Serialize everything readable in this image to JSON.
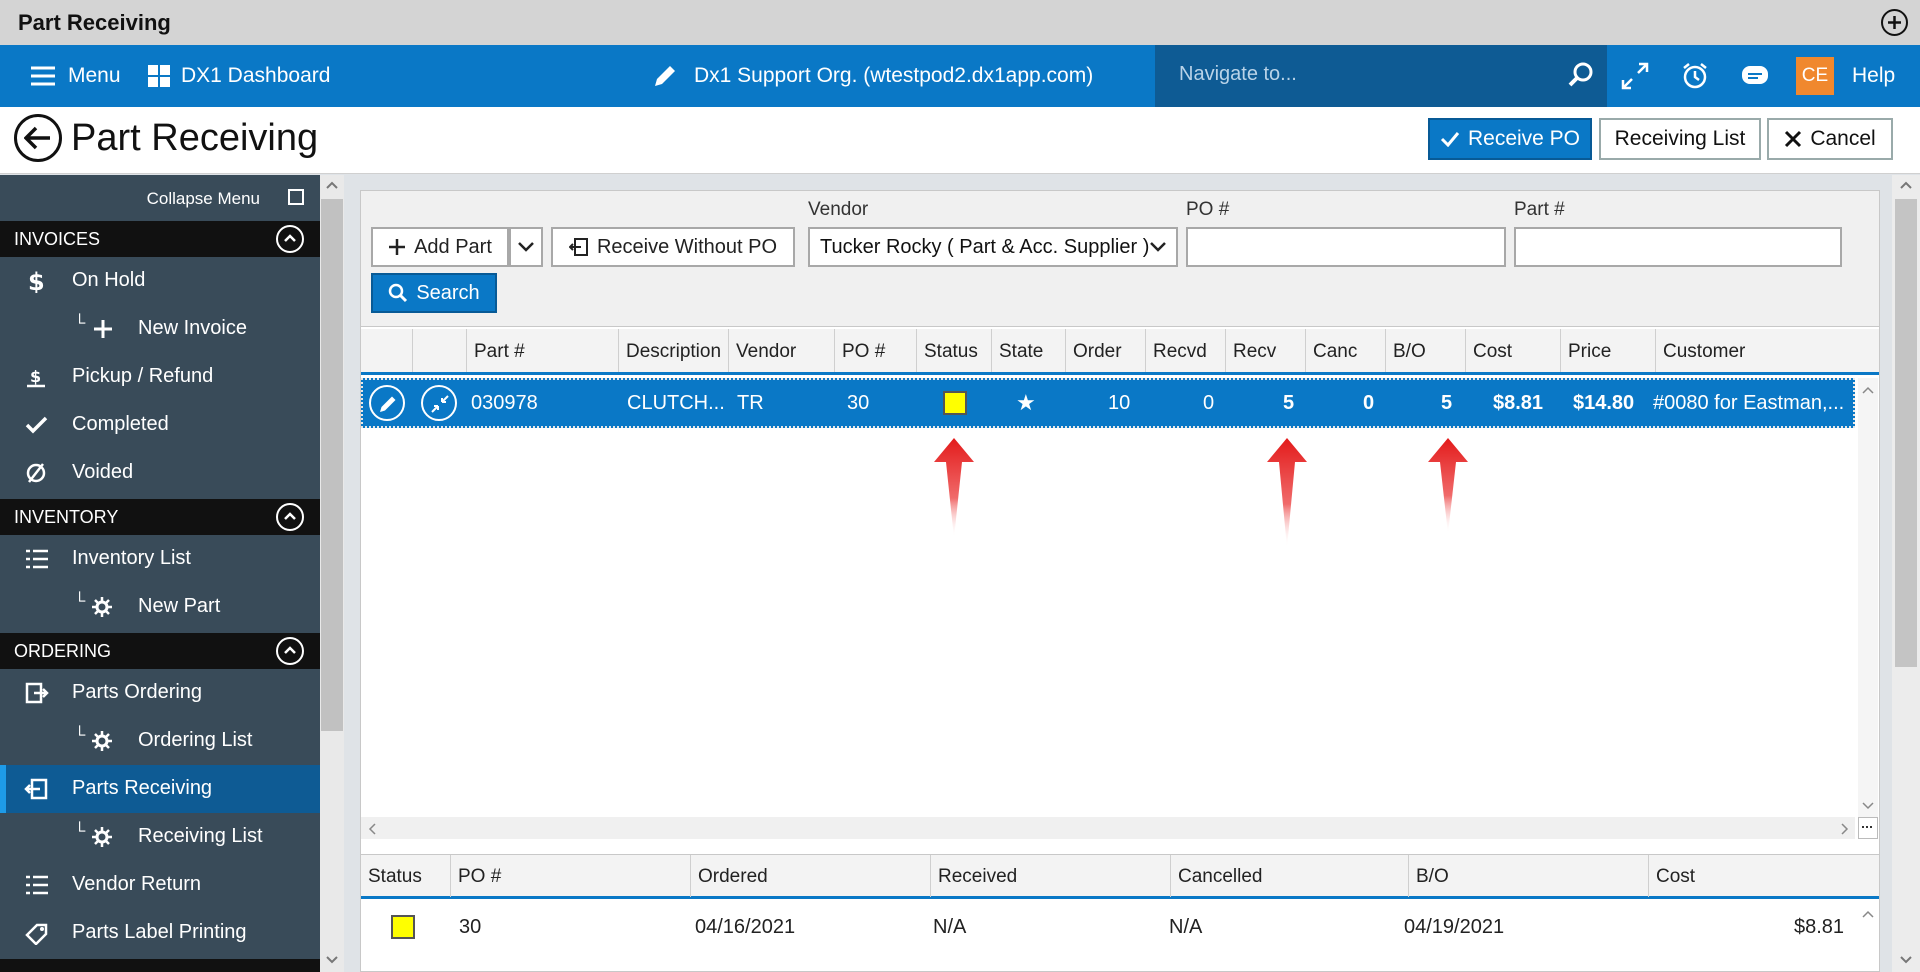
{
  "window": {
    "title": "Part Receiving"
  },
  "topnav": {
    "menu_label": "Menu",
    "dashboard_label": "DX1 Dashboard",
    "org_label": "Dx1 Support Org. (wtestpod2.dx1app.com)",
    "search_placeholder": "Navigate to...",
    "user_initials": "CE",
    "help_label": "Help"
  },
  "header": {
    "title": "Part Receiving",
    "receive_po_label": "Receive PO",
    "receiving_list_label": "Receiving List",
    "cancel_label": "Cancel"
  },
  "sidebar": {
    "collapse_label": "Collapse Menu",
    "sections": [
      {
        "title": "INVOICES",
        "items": [
          {
            "label": "On Hold",
            "icon": "dollar-icon"
          },
          {
            "label": "New Invoice",
            "icon": "plus-icon",
            "sub": true
          },
          {
            "label": "Pickup / Refund",
            "icon": "refund-icon"
          },
          {
            "label": "Completed",
            "icon": "check-icon"
          },
          {
            "label": "Voided",
            "icon": "void-icon"
          }
        ]
      },
      {
        "title": "INVENTORY",
        "items": [
          {
            "label": "Inventory List",
            "icon": "list-icon"
          },
          {
            "label": "New Part",
            "icon": "gear-icon",
            "sub": true
          }
        ]
      },
      {
        "title": "ORDERING",
        "items": [
          {
            "label": "Parts Ordering",
            "icon": "order-icon"
          },
          {
            "label": "Ordering List",
            "icon": "gear-icon",
            "sub": true
          },
          {
            "label": "Parts Receiving",
            "icon": "receive-icon",
            "active": true
          },
          {
            "label": "Receiving List",
            "icon": "gear-icon",
            "sub": true
          },
          {
            "label": "Vendor Return",
            "icon": "list-icon"
          },
          {
            "label": "Parts Label Printing",
            "icon": "label-icon"
          }
        ]
      }
    ]
  },
  "filter": {
    "add_part_label": "Add Part",
    "receive_without_po_label": "Receive Without PO",
    "vendor_label": "Vendor",
    "vendor_value": "Tucker Rocky ( Part & Acc. Supplier )",
    "po_label": "PO #",
    "po_value": "",
    "part_label": "Part #",
    "part_value": "",
    "search_label": "Search"
  },
  "grid": {
    "columns": [
      "Part #",
      "Description",
      "Vendor",
      "PO #",
      "Status",
      "State",
      "Order",
      "Recvd",
      "Recv",
      "Canc",
      "B/O",
      "Cost",
      "Price",
      "Customer"
    ],
    "rows": [
      {
        "part": "030978",
        "description": "CLUTCH...",
        "vendor": "TR",
        "po": "30",
        "status_color": "#ffff00",
        "state": "★",
        "order": "10",
        "recvd": "0",
        "recv": "5",
        "canc": "0",
        "bo": "5",
        "cost": "$8.81",
        "price": "$14.80",
        "customer": "#0080 for Eastman,..."
      }
    ]
  },
  "detail": {
    "columns": [
      "Status",
      "PO #",
      "Ordered",
      "Received",
      "Cancelled",
      "B/O",
      "Cost"
    ],
    "rows": [
      {
        "status_color": "#ffff00",
        "po": "30",
        "ordered": "04/16/2021",
        "received": "N/A",
        "cancelled": "N/A",
        "bo": "04/19/2021",
        "cost": "$8.81"
      }
    ]
  },
  "colors": {
    "accent": "#0a78c6",
    "sidebar": "#394b59",
    "highlight_arrow": "#e31b1b"
  }
}
